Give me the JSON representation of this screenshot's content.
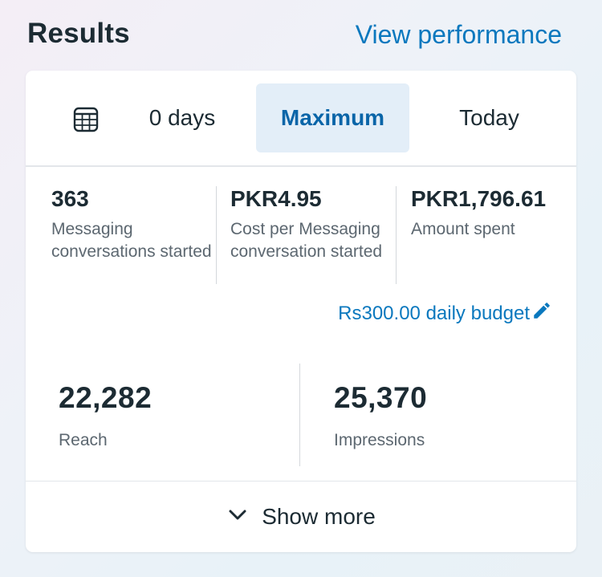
{
  "header": {
    "title": "Results",
    "view_link": "View performance"
  },
  "date_tabs": {
    "calendar_icon": "calendar-icon",
    "days": "0 days",
    "maximum": "Maximum",
    "today": "Today",
    "selected": "Maximum"
  },
  "metrics": [
    {
      "value": "363",
      "label": "Messaging conversations started"
    },
    {
      "value": "PKR4.95",
      "label": "Cost per Messaging conversation started"
    },
    {
      "value": "PKR1,796.61",
      "label": "Amount spent"
    }
  ],
  "budget": {
    "label": "Rs300.00 daily budget",
    "icon": "pencil-icon"
  },
  "big_stats": [
    {
      "value": "22,282",
      "label": "Reach"
    },
    {
      "value": "25,370",
      "label": "Impressions"
    }
  ],
  "footer": {
    "show_more": "Show more",
    "icon": "chevron-down-icon"
  },
  "colors": {
    "accent": "#0a78be",
    "selected_tab_bg": "#e3eef8",
    "text_primary": "#1c2b33",
    "text_secondary": "#5c6770"
  }
}
